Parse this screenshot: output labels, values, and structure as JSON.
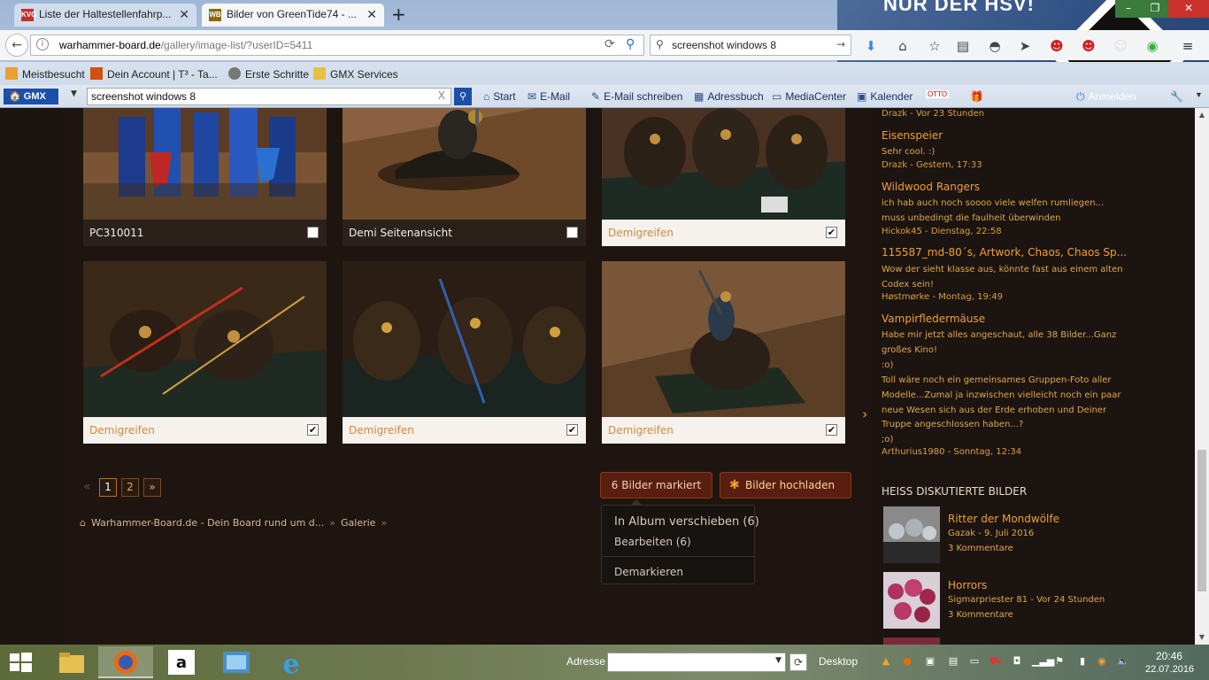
{
  "browser": {
    "tabs": [
      {
        "label": "Liste der Haltestellenfahrp...",
        "favicon": "kvg-icon"
      },
      {
        "label": "Bilder von GreenTide74 - ...",
        "favicon": "wb-icon"
      }
    ],
    "address": {
      "prefix": "warhammer-board.de",
      "path": "/gallery/image-list/?userID=5411"
    },
    "search": {
      "value": "screenshot windows 8"
    },
    "banner_text": "NUR DER HSV!",
    "bookmarks": [
      "Meistbesucht",
      "Dein Account | T³ - Ta...",
      "Erste Schritte",
      "GMX Services"
    ],
    "gmx": {
      "logo": "GMX",
      "search_value": "screenshot windows 8",
      "clear": "X",
      "links": [
        "Start",
        "E-Mail",
        "E-Mail schreiben",
        "Adressbuch",
        "MediaCenter",
        "Kalender"
      ],
      "login": "Anmelden"
    }
  },
  "gallery": {
    "thumbs": [
      {
        "caption": "PC310011",
        "checked": false,
        "check": ""
      },
      {
        "caption": "Demi Seitenansicht",
        "checked": false,
        "check": ""
      },
      {
        "caption": "Demigreifen",
        "checked": true,
        "check": "✔"
      },
      {
        "caption": "Demigreifen",
        "checked": true,
        "check": "✔"
      },
      {
        "caption": "Demigreifen",
        "checked": true,
        "check": "✔"
      },
      {
        "caption": "Demigreifen",
        "checked": true,
        "check": "✔"
      }
    ],
    "pagination": {
      "prev": "«",
      "pages": [
        "1",
        "2"
      ],
      "next": "»",
      "current": "1"
    },
    "marked_button": "6 Bilder markiert",
    "upload_button": "Bilder hochladen",
    "dropdown": [
      "In Album verschieben (6)",
      "Bearbeiten (6)",
      "Demarkieren"
    ],
    "breadcrumb": [
      "Warhammer-Board.de - Dein Board rund um d...",
      "Galerie"
    ]
  },
  "sidebar": {
    "comments": [
      {
        "meta": "Drazk - Vor 23 Stunden"
      },
      {
        "title": "Eisenspeier",
        "lines": [
          "Sehr cool. :)"
        ],
        "meta": "Drazk - Gestern, 17:33"
      },
      {
        "title": "Wildwood Rangers",
        "lines": [
          "ich hab auch noch soooo viele welfen rumliegen...",
          "muss unbedingt die faulheit überwinden"
        ],
        "meta": "Hickok45 - Dienstag, 22:58"
      },
      {
        "title": "115587_md-80´s, Artwork, Chaos, Chaos Sp...",
        "lines": [
          "Wow der sieht klasse aus, könnte fast aus einem alten",
          "Codex sein!"
        ],
        "meta": "Høstmørke - Montag, 19:49"
      },
      {
        "title": "Vampirfledermäuse",
        "lines": [
          "Habe mir jetzt alles angeschaut, alle 38 Bilder...Ganz",
          "großes Kino!",
          ":o)",
          "Toll wäre noch ein gemeinsames Gruppen-Foto aller",
          "Modelle...Zumal ja inzwischen vielleicht noch ein paar",
          "neue Wesen sich aus der Erde erhoben und Deiner",
          "Truppe angeschlossen haben...?",
          ";o)"
        ],
        "meta": "Arthurius1980 - Sonntag, 12:34"
      }
    ],
    "hot_heading": "HEISS DISKUTIERTE BILDER",
    "hot": [
      {
        "title": "Ritter der Mondwölfe",
        "meta": "Gazak - 9. Juli 2016",
        "comments": "3 Kommentare"
      },
      {
        "title": "Horrors",
        "meta": "Sigmarpriester 81 - Vor 24 Stunden",
        "comments": "3 Kommentare"
      }
    ]
  },
  "taskbar": {
    "address_label": "Adresse",
    "desktop_label": "Desktop",
    "time": "20:46",
    "date": "22.07.2016"
  }
}
